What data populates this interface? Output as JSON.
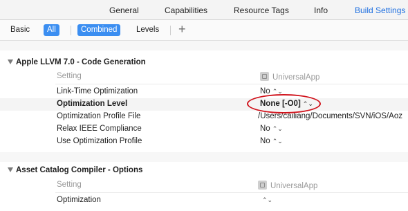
{
  "tabs": [
    "General",
    "Capabilities",
    "Resource Tags",
    "Info",
    "Build Settings"
  ],
  "active_tab": "Build Settings",
  "filters": {
    "basic": "Basic",
    "all": "All",
    "combined": "Combined",
    "levels": "Levels",
    "add": "+"
  },
  "sections": [
    {
      "title": "Apple LLVM 7.0 - Code Generation",
      "header": {
        "setting": "Setting",
        "target": "UniversalApp"
      },
      "rows": [
        {
          "name": "Link-Time Optimization",
          "value": "No",
          "stepper": "⌃⌄"
        },
        {
          "name": "Optimization Level",
          "value": "None [-O0]",
          "stepper": "⌃⌄"
        },
        {
          "name": "Optimization Profile File",
          "value": "/Users/cailiang/Documents/SVN/iOS/Aoz"
        },
        {
          "name": "Relax IEEE Compliance",
          "value": "No",
          "stepper": "⌃⌄"
        },
        {
          "name": "Use Optimization Profile",
          "value": "No",
          "stepper": "⌃⌄"
        }
      ]
    },
    {
      "title": "Asset Catalog Compiler - Options",
      "header": {
        "setting": "Setting",
        "target": "UniversalApp"
      },
      "rows": [
        {
          "name": "Optimization",
          "value": "",
          "stepper": "⌃⌄"
        }
      ]
    }
  ],
  "colors": {
    "accent": "#3b8ef1",
    "highlight": "#d0121b"
  }
}
